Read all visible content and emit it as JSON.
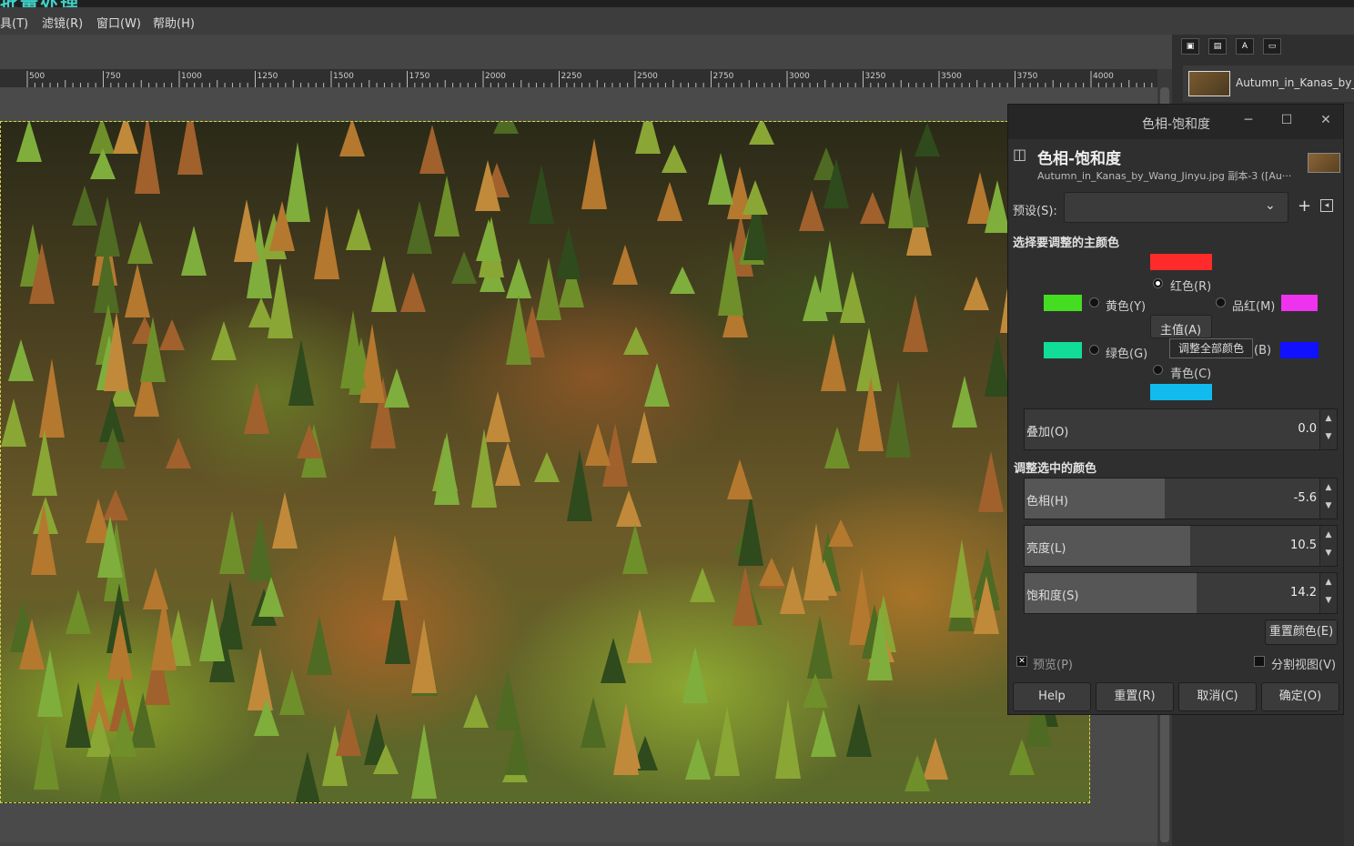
{
  "window": {
    "title_fragment": "批量处理"
  },
  "menubar": {
    "items": [
      "具(T)",
      "滤镜(R)",
      "窗口(W)",
      "帮助(H)"
    ]
  },
  "ruler": {
    "ticks": [
      "500",
      "750",
      "1000",
      "1250",
      "1500",
      "1750",
      "2000",
      "2250",
      "2500",
      "2750",
      "3000",
      "3250",
      "3500",
      "3750",
      "4000"
    ]
  },
  "layers": {
    "layer_name": "Autumn_in_Kanas_by_Wang_Jinyu"
  },
  "dialog": {
    "window_title": "色相-饱和度",
    "header_title": "色相-饱和度",
    "header_subtitle": "Autumn_in_Kanas_by_Wang_Jinyu.jpg 副本-3 ([Au···",
    "preset_label": "预设(S):",
    "preset_value": "",
    "section_primary": "选择要调整的主颜色",
    "colors": {
      "red": {
        "label": "红色(R)",
        "swatch": "#ff2a2a",
        "selected": true
      },
      "yellow": {
        "label": "黄色(Y)",
        "swatch": "#44dd22"
      },
      "magenta": {
        "label": "品红(M)",
        "swatch": "#ee33ee"
      },
      "green": {
        "label": "绿色(G)",
        "swatch": "#11dd99"
      },
      "blue": {
        "label": "(B)",
        "swatch": "#1111ff"
      },
      "cyan": {
        "label": "青色(C)",
        "swatch": "#11bbee"
      }
    },
    "master_label": "主值(A)",
    "tooltip": "调整全部颜色",
    "overlap": {
      "label": "叠加(O)",
      "value": "0.0"
    },
    "section_adjust": "调整选中的颜色",
    "hue": {
      "label": "色相(H)",
      "value": "-5.6",
      "level": 0.45
    },
    "lightness": {
      "label": "亮度(L)",
      "value": "10.5",
      "level": 0.53
    },
    "saturation": {
      "label": "饱和度(S)",
      "value": "14.2",
      "level": 0.55
    },
    "reset_color_button": "重置颜色(E)",
    "preview_label": "预览(P)",
    "split_view_label": "分割视图(V)",
    "buttons": {
      "help": "Help",
      "reset": "重置(R)",
      "cancel": "取消(C)",
      "ok": "确定(O)"
    }
  }
}
